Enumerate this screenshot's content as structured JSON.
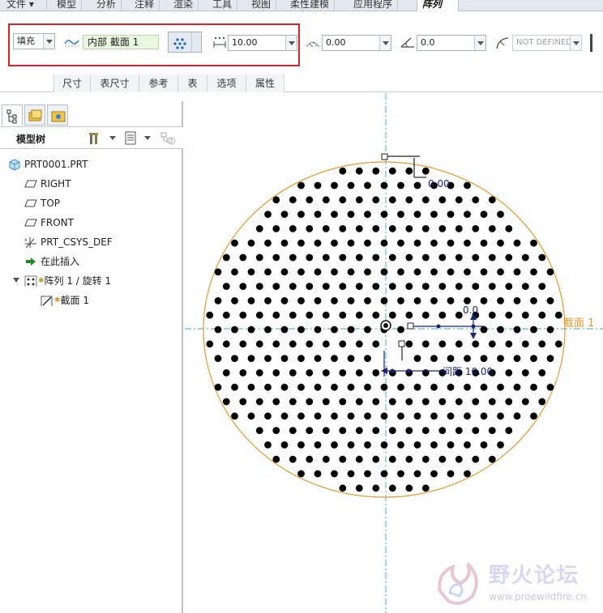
{
  "menu": {
    "items": [
      "文件",
      "模型",
      "分析",
      "注释",
      "渲染",
      "工具",
      "视图",
      "柔性建模",
      "应用程序",
      "阵列"
    ],
    "active_index": 9
  },
  "ribbon": {
    "fill_combo": "填充",
    "sketch_field": "内部 截面 1",
    "spacing_value": "10.00",
    "border_value": "0.00",
    "rotation_value": "0.0",
    "radius_value": "NOT DEFINED",
    "tabs": [
      "尺寸",
      "表尺寸",
      "参考",
      "表",
      "选项",
      "属性"
    ],
    "highlight_color": "#d9232b"
  },
  "model_tree": {
    "title": "模型树",
    "items": [
      {
        "label": "PRT0001.PRT",
        "icon": "part-icon"
      },
      {
        "label": "RIGHT",
        "icon": "datum-plane-icon"
      },
      {
        "label": "TOP",
        "icon": "datum-plane-icon"
      },
      {
        "label": "FRONT",
        "icon": "datum-plane-icon"
      },
      {
        "label": "PRT_CSYS_DEF",
        "icon": "csys-icon"
      },
      {
        "label": "在此插入",
        "icon": "insert-arrow-icon"
      },
      {
        "label": "阵列 1 / 旋转 1",
        "icon": "pattern-icon"
      },
      {
        "label": "截面 1",
        "icon": "sketch-icon"
      }
    ]
  },
  "canvas": {
    "boundary_label": "截面 1",
    "border_dim_label": "0.00",
    "rotation_dim_label": "0.0",
    "spacing_dim_label": "间距 10.00",
    "circle_color": "#e39a2b",
    "axis_color": "#2fb4c9",
    "dim_color": "#1a237e"
  },
  "watermark": {
    "text": "野火论坛",
    "url": "www.proewildfire.cn"
  }
}
